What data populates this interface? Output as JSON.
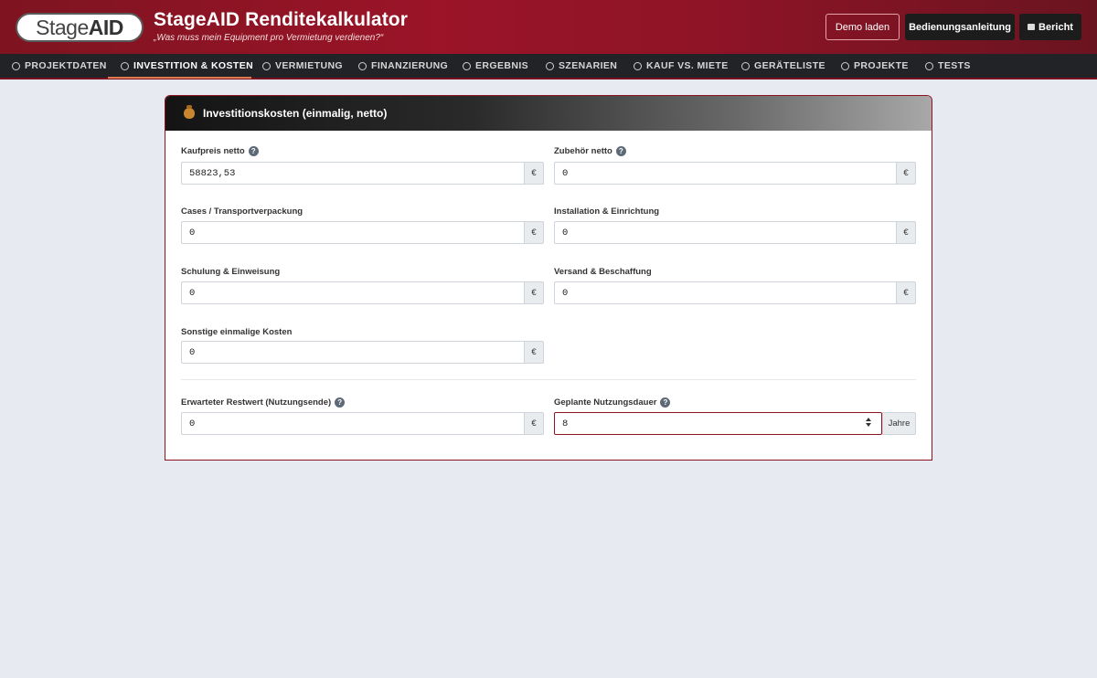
{
  "header": {
    "logo_part1": "Stage",
    "logo_part2": "AID",
    "title": "StageAID Renditekalkulator",
    "subtitle": "„Was muss mein Equipment pro Vermietung verdienen?“",
    "buttons": {
      "demo": "Demo laden",
      "manual": "Bedienungsanleitung",
      "report": "Bericht"
    }
  },
  "nav": {
    "items": [
      {
        "label": "PROJEKTDATEN"
      },
      {
        "label": "INVESTITION & KOSTEN"
      },
      {
        "label": "VERMIETUNG"
      },
      {
        "label": "FINANZIERUNG"
      },
      {
        "label": "ERGEBNIS"
      },
      {
        "label": "SZENARIEN"
      },
      {
        "label": "KAUF VS. MIETE"
      },
      {
        "label": "GERÄTELISTE"
      },
      {
        "label": "PROJEKTE"
      },
      {
        "label": "TESTS"
      }
    ],
    "active": "INVESTITION & KOSTEN"
  },
  "panel": {
    "title": "Investitionskosten (einmalig, netto)",
    "fields": {
      "kaufpreis": {
        "label": "Kaufpreis netto",
        "value": "58823,53",
        "unit": "€"
      },
      "zubehoer": {
        "label": "Zubehör netto",
        "value": "0",
        "unit": "€"
      },
      "cases": {
        "label": "Cases / Transportverpackung",
        "value": "0",
        "unit": "€"
      },
      "installation": {
        "label": "Installation & Einrichtung",
        "value": "0",
        "unit": "€"
      },
      "schulung": {
        "label": "Schulung & Einweisung",
        "value": "0",
        "unit": "€"
      },
      "versand": {
        "label": "Versand & Beschaffung",
        "value": "0",
        "unit": "€"
      },
      "sonstige": {
        "label": "Sonstige einmalige Kosten",
        "value": "0",
        "unit": "€"
      },
      "restwert": {
        "label": "Erwarteter Restwert (Nutzungsende)",
        "value": "0",
        "unit": "€"
      },
      "nutzungsdauer": {
        "label": "Geplante Nutzungsdauer",
        "value": "8",
        "unit": "Jahre"
      }
    },
    "help_glyph": "?"
  },
  "colors": {
    "brand": "#9b1428",
    "nav_bg": "#212326",
    "accent_underline": "#e07a50"
  }
}
